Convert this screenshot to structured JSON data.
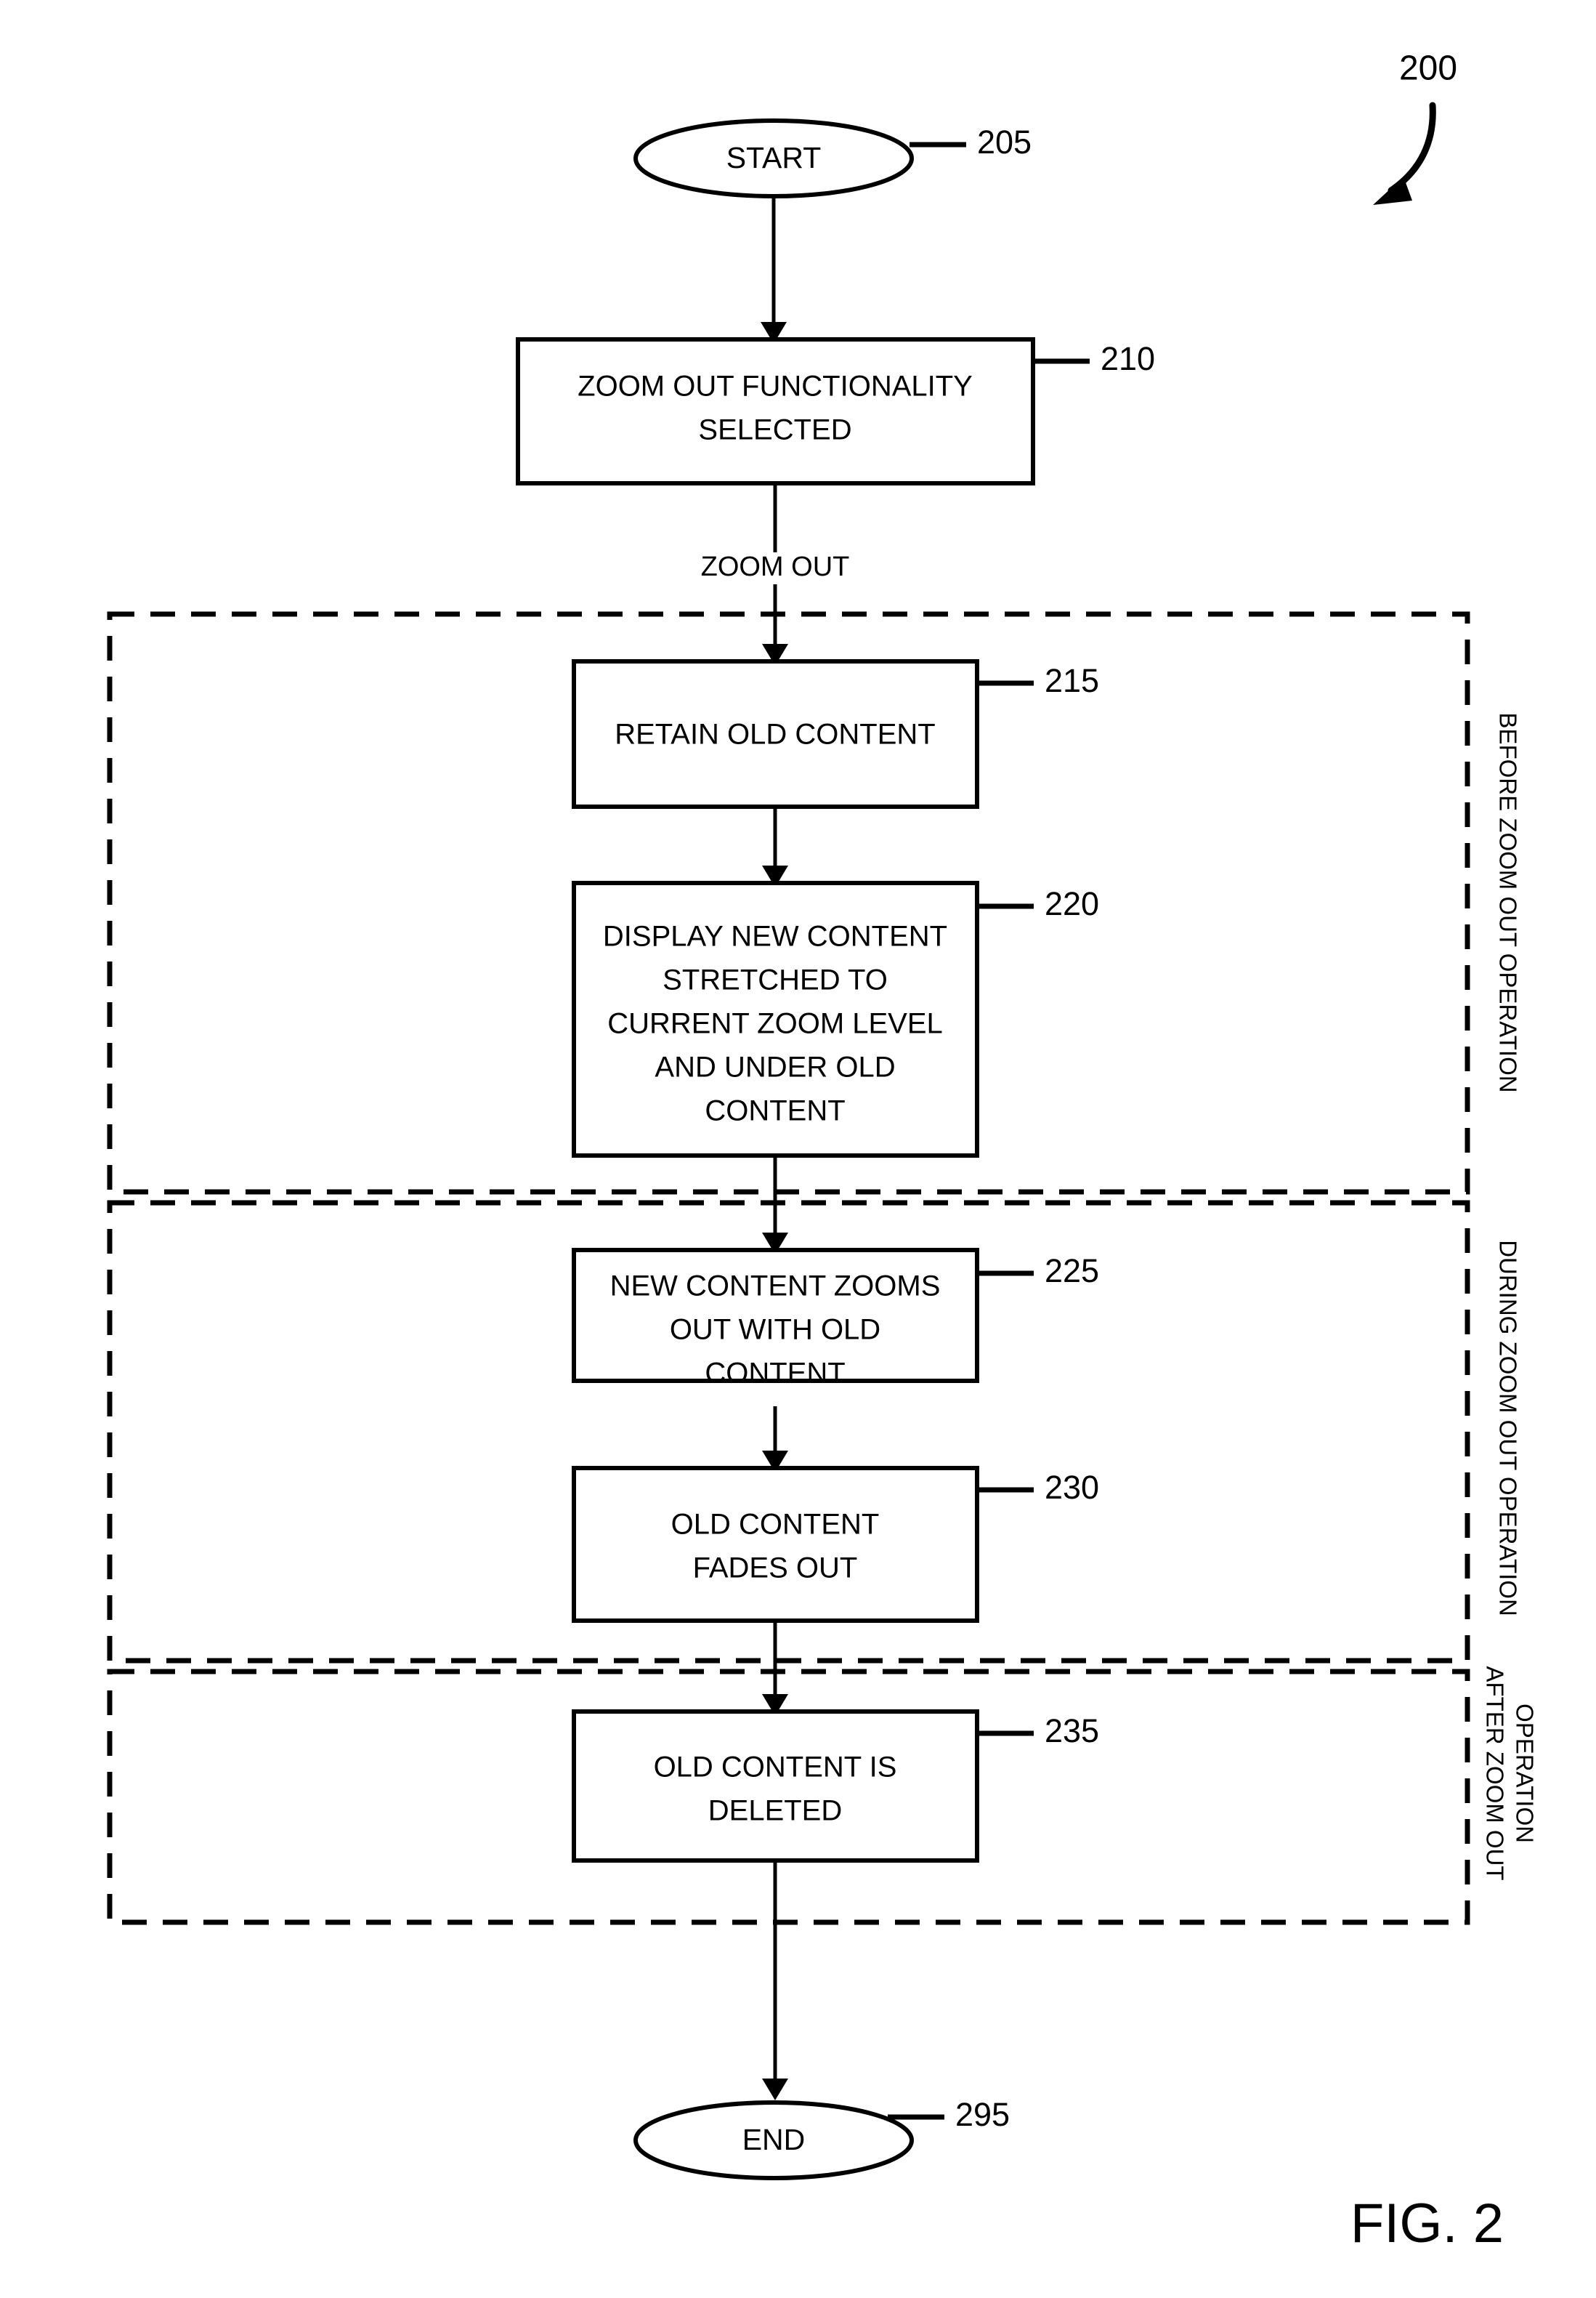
{
  "figure": {
    "caption": "FIG. 2",
    "overall_reference": "200"
  },
  "nodes": [
    {
      "id": "start",
      "shape": "ellipse",
      "label": "START",
      "reference": "205"
    },
    {
      "id": "step210",
      "shape": "process",
      "label_lines": [
        "ZOOM OUT FUNCTIONALITY",
        "SELECTED"
      ],
      "reference": "210"
    },
    {
      "id": "step215",
      "shape": "process",
      "label_lines": [
        "RETAIN OLD CONTENT"
      ],
      "reference": "215"
    },
    {
      "id": "step220",
      "shape": "process",
      "label_lines": [
        "DISPLAY NEW CONTENT",
        "STRETCHED TO",
        "CURRENT ZOOM LEVEL",
        "AND UNDER OLD",
        "CONTENT"
      ],
      "reference": "220"
    },
    {
      "id": "step225",
      "shape": "process",
      "label_lines": [
        "NEW CONTENT ZOOMS",
        "OUT WITH OLD",
        "CONTENT"
      ],
      "reference": "225"
    },
    {
      "id": "step230",
      "shape": "process",
      "label_lines": [
        "OLD CONTENT",
        "FADES OUT"
      ],
      "reference": "230"
    },
    {
      "id": "step235",
      "shape": "process",
      "label_lines": [
        "OLD CONTENT IS",
        "DELETED"
      ],
      "reference": "235"
    },
    {
      "id": "end",
      "shape": "ellipse",
      "label": "END",
      "reference": "295"
    }
  ],
  "edge_labels": [
    {
      "id": "zoom-out-edge",
      "text": "ZOOM OUT"
    }
  ],
  "phase_groups": [
    {
      "id": "before",
      "label_lines": [
        "BEFORE ZOOM OUT OPERATION"
      ]
    },
    {
      "id": "during",
      "label_lines": [
        "DURING ZOOM OUT OPERATION"
      ]
    },
    {
      "id": "after",
      "label_lines": [
        "AFTER ZOOM OUT",
        "OPERATION"
      ]
    }
  ],
  "colors": {
    "ink": "#000000",
    "paper": "#ffffff"
  }
}
